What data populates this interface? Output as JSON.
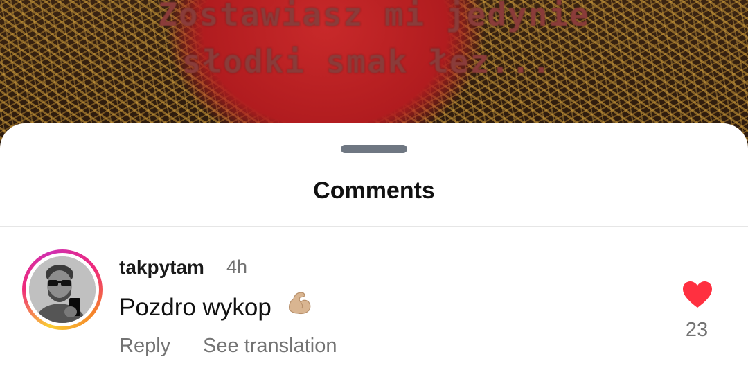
{
  "post": {
    "caption_line1": "Zostawiasz mi jedynie",
    "caption_line2": "słodki smak łez..."
  },
  "sheet": {
    "title": "Comments"
  },
  "comments": [
    {
      "username": "takpytam",
      "time": "4h",
      "text": "Pozdro wykop",
      "emoji": "flexed-biceps-icon",
      "reply_label": "Reply",
      "translate_label": "See translation",
      "like_count": "23",
      "liked": true
    }
  ],
  "colors": {
    "like": "#ff3040",
    "secondary_text": "#737373",
    "handle": "#6f7782"
  }
}
